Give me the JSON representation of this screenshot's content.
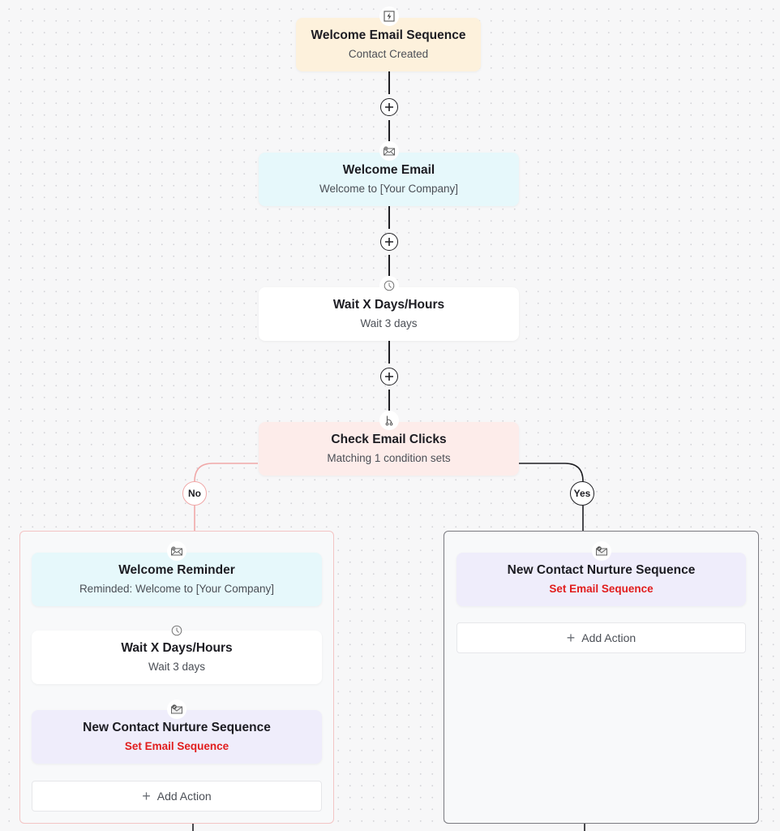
{
  "flow": {
    "trigger": {
      "icon": "lightning-icon",
      "title": "Welcome Email Sequence",
      "subtitle": "Contact Created",
      "color": "#fdf1dc"
    },
    "steps": [
      {
        "icon": "email-icon",
        "title": "Welcome Email",
        "subtitle": "Welcome to [Your Company]",
        "color": "#e6f8fb"
      },
      {
        "icon": "clock-icon",
        "title": "Wait X Days/Hours",
        "subtitle": "Wait 3 days",
        "color": "#ffffff"
      },
      {
        "icon": "branch-icon",
        "title": "Check Email Clicks",
        "subtitle": "Matching 1 condition sets",
        "color": "#fdecea"
      }
    ],
    "add_step_icon": "plus-circle-icon",
    "branches": {
      "no": {
        "label": "No",
        "color": "#f0a8a8",
        "steps": [
          {
            "icon": "email-icon",
            "title": "Welcome Reminder",
            "subtitle": "Reminded: Welcome to [Your Company]",
            "color": "#e6f8fb"
          },
          {
            "icon": "clock-icon",
            "title": "Wait X Days/Hours",
            "subtitle": "Wait 3 days",
            "color": "#ffffff"
          },
          {
            "icon": "email-sequence-icon",
            "title": "New Contact Nurture Sequence",
            "subtitle": "Set Email Sequence",
            "color": "#efedfb"
          }
        ],
        "add_action": "Add Action"
      },
      "yes": {
        "label": "Yes",
        "color": "#1f1f23",
        "steps": [
          {
            "icon": "email-sequence-icon",
            "title": "New Contact Nurture Sequence",
            "subtitle": "Set Email Sequence",
            "color": "#efedfb"
          }
        ],
        "add_action": "Add Action"
      }
    },
    "warning_color": "#e11d1d"
  }
}
